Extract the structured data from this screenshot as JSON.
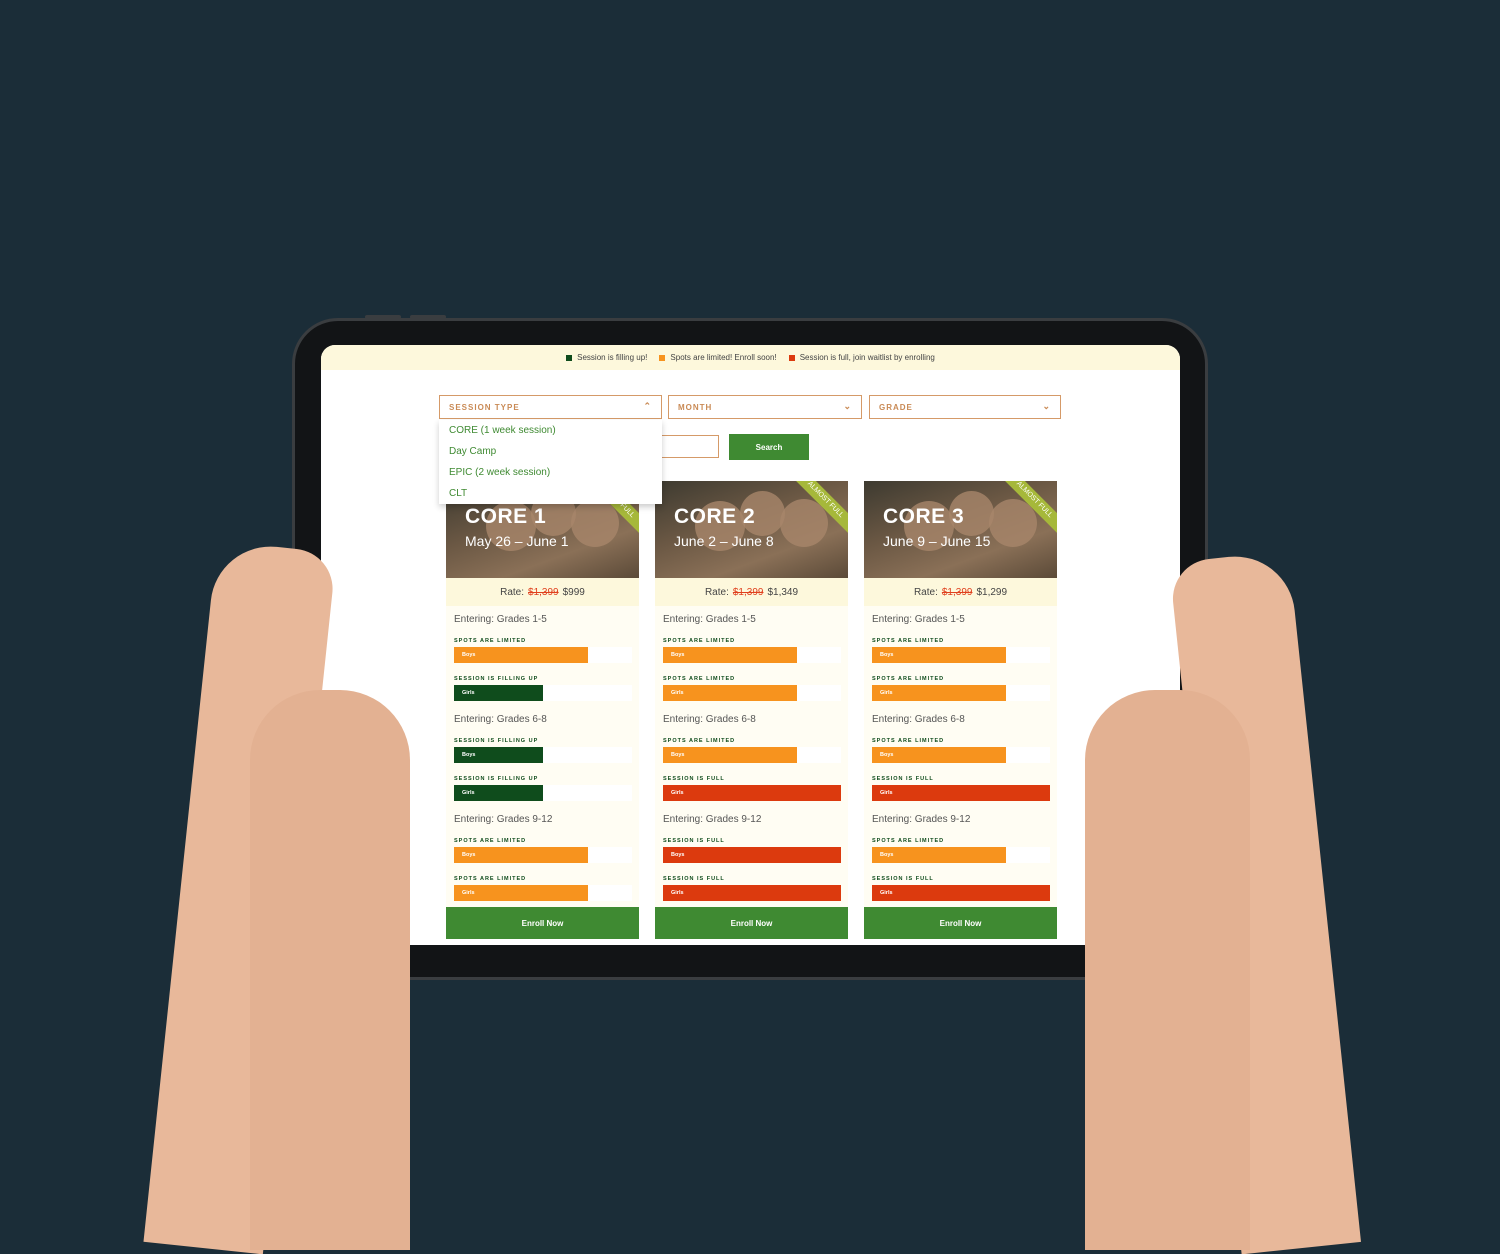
{
  "colors": {
    "filling": "#0f4c1c",
    "limited": "#f7931e",
    "full": "#dc3a0e",
    "accent": "#3f8a32",
    "ribbon": "#a6b83a"
  },
  "legend": [
    {
      "label": "Session is filling up!",
      "color": "#0f4c1c"
    },
    {
      "label": "Spots are limited! Enroll soon!",
      "color": "#f7931e"
    },
    {
      "label": "Session is full, join waitlist by enrolling",
      "color": "#dc3a0e"
    }
  ],
  "filters": {
    "session_type": {
      "label": "SESSION TYPE",
      "icon": "chevron-up-icon",
      "open": true,
      "options": [
        "CORE (1 week session)",
        "Day Camp",
        "EPIC (2 week session)",
        "CLT"
      ]
    },
    "month": {
      "label": "MONTH",
      "icon": "chevron-down-icon"
    },
    "grade": {
      "label": "GRADE",
      "icon": "chevron-down-icon"
    },
    "search_label": "Search"
  },
  "cards": [
    {
      "title": "CORE 1",
      "dates": "May 26 – June 1",
      "ribbon": "ALMOST FULL",
      "rate_label": "Rate:",
      "old_price": "$1,399",
      "price": "$999",
      "enroll": "Enroll Now",
      "groups": [
        {
          "grade": "Entering: Grades 1-5",
          "bars": [
            {
              "status": "SPOTS ARE LIMITED",
              "gender": "Boys",
              "fill_pct": 75,
              "color": "#f7931e"
            },
            {
              "status": "SESSION IS FILLING UP",
              "gender": "Girls",
              "fill_pct": 50,
              "color": "#0f4c1c"
            }
          ]
        },
        {
          "grade": "Entering: Grades 6-8",
          "bars": [
            {
              "status": "SESSION IS FILLING UP",
              "gender": "Boys",
              "fill_pct": 50,
              "color": "#0f4c1c"
            },
            {
              "status": "SESSION IS FILLING UP",
              "gender": "Girls",
              "fill_pct": 50,
              "color": "#0f4c1c"
            }
          ]
        },
        {
          "grade": "Entering: Grades 9-12",
          "bars": [
            {
              "status": "SPOTS ARE LIMITED",
              "gender": "Boys",
              "fill_pct": 75,
              "color": "#f7931e"
            },
            {
              "status": "SPOTS ARE LIMITED",
              "gender": "Girls",
              "fill_pct": 75,
              "color": "#f7931e"
            }
          ]
        }
      ]
    },
    {
      "title": "CORE 2",
      "dates": "June 2 – June 8",
      "ribbon": "ALMOST FULL",
      "rate_label": "Rate:",
      "old_price": "$1,399",
      "price": "$1,349",
      "enroll": "Enroll Now",
      "groups": [
        {
          "grade": "Entering: Grades 1-5",
          "bars": [
            {
              "status": "SPOTS ARE LIMITED",
              "gender": "Boys",
              "fill_pct": 75,
              "color": "#f7931e"
            },
            {
              "status": "SPOTS ARE LIMITED",
              "gender": "Girls",
              "fill_pct": 75,
              "color": "#f7931e"
            }
          ]
        },
        {
          "grade": "Entering: Grades 6-8",
          "bars": [
            {
              "status": "SPOTS ARE LIMITED",
              "gender": "Boys",
              "fill_pct": 75,
              "color": "#f7931e"
            },
            {
              "status": "SESSION IS FULL",
              "gender": "Girls",
              "fill_pct": 100,
              "color": "#dc3a0e"
            }
          ]
        },
        {
          "grade": "Entering: Grades 9-12",
          "bars": [
            {
              "status": "SESSION IS FULL",
              "gender": "Boys",
              "fill_pct": 100,
              "color": "#dc3a0e"
            },
            {
              "status": "SESSION IS FULL",
              "gender": "Girls",
              "fill_pct": 100,
              "color": "#dc3a0e"
            }
          ]
        }
      ]
    },
    {
      "title": "CORE 3",
      "dates": "June 9 – June 15",
      "ribbon": "ALMOST FULL",
      "rate_label": "Rate:",
      "old_price": "$1,399",
      "price": "$1,299",
      "enroll": "Enroll Now",
      "groups": [
        {
          "grade": "Entering: Grades 1-5",
          "bars": [
            {
              "status": "SPOTS ARE LIMITED",
              "gender": "Boys",
              "fill_pct": 75,
              "color": "#f7931e"
            },
            {
              "status": "SPOTS ARE LIMITED",
              "gender": "Girls",
              "fill_pct": 75,
              "color": "#f7931e"
            }
          ]
        },
        {
          "grade": "Entering: Grades 6-8",
          "bars": [
            {
              "status": "SPOTS ARE LIMITED",
              "gender": "Boys",
              "fill_pct": 75,
              "color": "#f7931e"
            },
            {
              "status": "SESSION IS FULL",
              "gender": "Girls",
              "fill_pct": 100,
              "color": "#dc3a0e"
            }
          ]
        },
        {
          "grade": "Entering: Grades 9-12",
          "bars": [
            {
              "status": "SPOTS ARE LIMITED",
              "gender": "Boys",
              "fill_pct": 75,
              "color": "#f7931e"
            },
            {
              "status": "SESSION IS FULL",
              "gender": "Girls",
              "fill_pct": 100,
              "color": "#dc3a0e"
            }
          ]
        }
      ]
    }
  ]
}
